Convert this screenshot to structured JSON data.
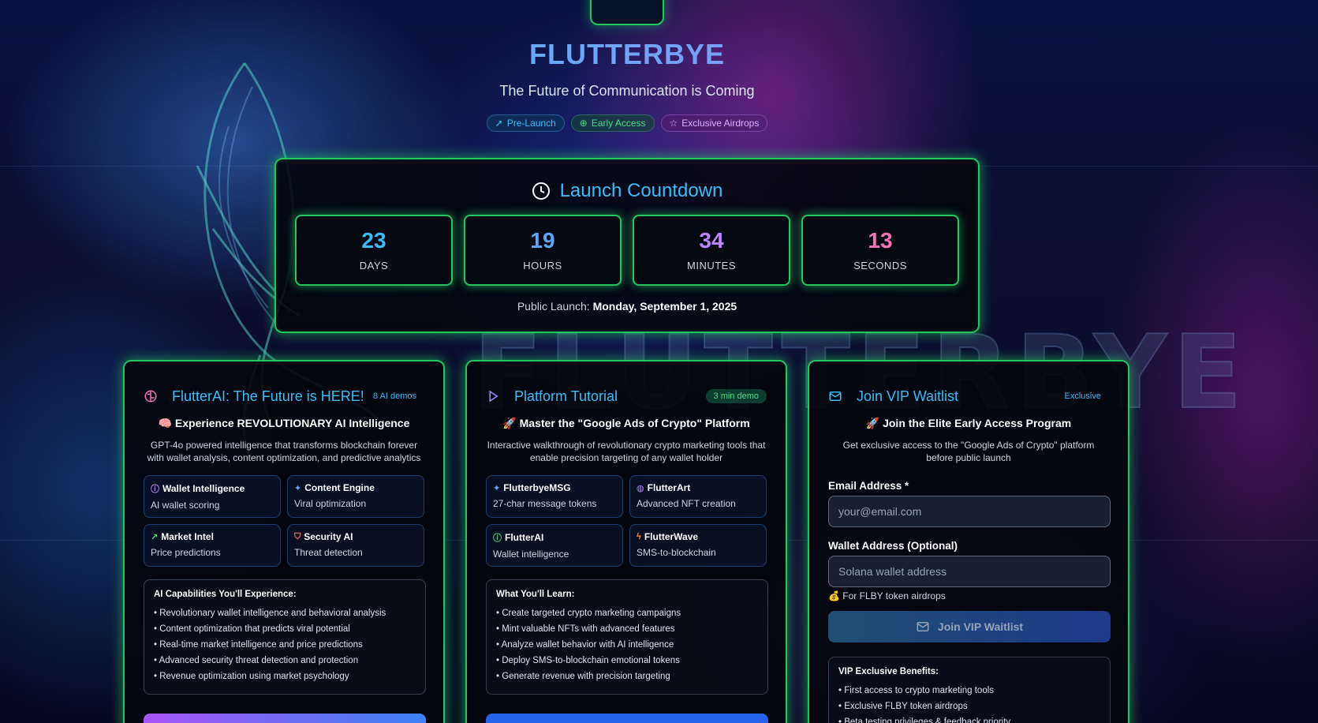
{
  "brand": "FLUTTERBYE",
  "tagline": "The Future of Communication is Coming",
  "badges": [
    "Pre-Launch",
    "Early Access",
    "Exclusive Airdrops"
  ],
  "countdown": {
    "title": "Launch Countdown",
    "units": [
      {
        "value": "23",
        "label": "DAYS",
        "color": "#38bdf8"
      },
      {
        "value": "19",
        "label": "HOURS",
        "color": "#60a5fa"
      },
      {
        "value": "34",
        "label": "MINUTES",
        "color": "#c084fc"
      },
      {
        "value": "13",
        "label": "SECONDS",
        "color": "#f472b6"
      }
    ],
    "launch_prefix": "Public Launch:",
    "launch_date": "Monday, September 1, 2025"
  },
  "cards": {
    "ai": {
      "title": "FlutterAI: The Future is HERE!",
      "pill": "8 AI demos",
      "subtitle": "🧠 Experience REVOLUTIONARY AI Intelligence",
      "description": "GPT-4o powered intelligence that transforms blockchain forever with wallet analysis, content optimization, and predictive analytics",
      "features": [
        {
          "title": "Wallet Intelligence",
          "desc": "AI wallet scoring",
          "icon": "brain-icon",
          "glyph": "ⓘ",
          "color": "#c084fc"
        },
        {
          "title": "Content Engine",
          "desc": "Viral optimization",
          "icon": "sparkles-icon",
          "glyph": "✦",
          "color": "#60a5fa"
        },
        {
          "title": "Market Intel",
          "desc": "Price predictions",
          "icon": "trending-up-icon",
          "glyph": "↗",
          "color": "#4ade80"
        },
        {
          "title": "Security AI",
          "desc": "Threat detection",
          "icon": "shield-icon",
          "glyph": "⛉",
          "color": "#f87171"
        }
      ],
      "list_title": "AI Capabilities You'll Experience:",
      "list": [
        "• Revolutionary wallet intelligence and behavioral analysis",
        "• Content optimization that predicts viral potential",
        "• Real-time market intelligence and price predictions",
        "• Advanced security threat detection and protection",
        "• Revenue optimization using market psychology"
      ]
    },
    "tutorial": {
      "title": "Platform Tutorial",
      "pill": "3 min demo",
      "subtitle": "🚀 Master the \"Google Ads of Crypto\" Platform",
      "description": "Interactive walkthrough of revolutionary crypto marketing tools that enable precision targeting of any wallet holder",
      "features": [
        {
          "title": "FlutterbyeMSG",
          "desc": "27-char message tokens",
          "icon": "sparkles-icon",
          "glyph": "✦",
          "color": "#60a5fa"
        },
        {
          "title": "FlutterArt",
          "desc": "Advanced NFT creation",
          "icon": "palette-icon",
          "glyph": "◍",
          "color": "#c084fc"
        },
        {
          "title": "FlutterAI",
          "desc": "Wallet intelligence",
          "icon": "brain-icon",
          "glyph": "ⓘ",
          "color": "#4ade80"
        },
        {
          "title": "FlutterWave",
          "desc": "SMS-to-blockchain",
          "icon": "zap-icon",
          "glyph": "ϟ",
          "color": "#fb923c"
        }
      ],
      "list_title": "What You'll Learn:",
      "list": [
        "• Create targeted crypto marketing campaigns",
        "• Mint valuable NFTs with advanced features",
        "• Analyze wallet behavior with AI intelligence",
        "• Deploy SMS-to-blockchain emotional tokens",
        "• Generate revenue with precision targeting"
      ]
    },
    "waitlist": {
      "title": "Join VIP Waitlist",
      "pill": "Exclusive",
      "subtitle": "🚀 Join the Elite Early Access Program",
      "description": "Get exclusive access to the \"Google Ads of Crypto\" platform before public launch",
      "email_label": "Email Address *",
      "email_placeholder": "your@email.com",
      "wallet_label": "Wallet Address (Optional)",
      "wallet_placeholder": "Solana wallet address",
      "note": "💰 For FLBY token airdrops",
      "button": "Join VIP Waitlist",
      "list_title": "VIP Exclusive Benefits:",
      "list": [
        "• First access to crypto marketing tools",
        "• Exclusive FLBY token airdrops",
        "• Beta testing privileges & feedback priority"
      ]
    }
  },
  "colors": {
    "accent_green": "#22c55e",
    "accent_blue": "#38bdf8",
    "accent_purple": "#a78bfa"
  }
}
